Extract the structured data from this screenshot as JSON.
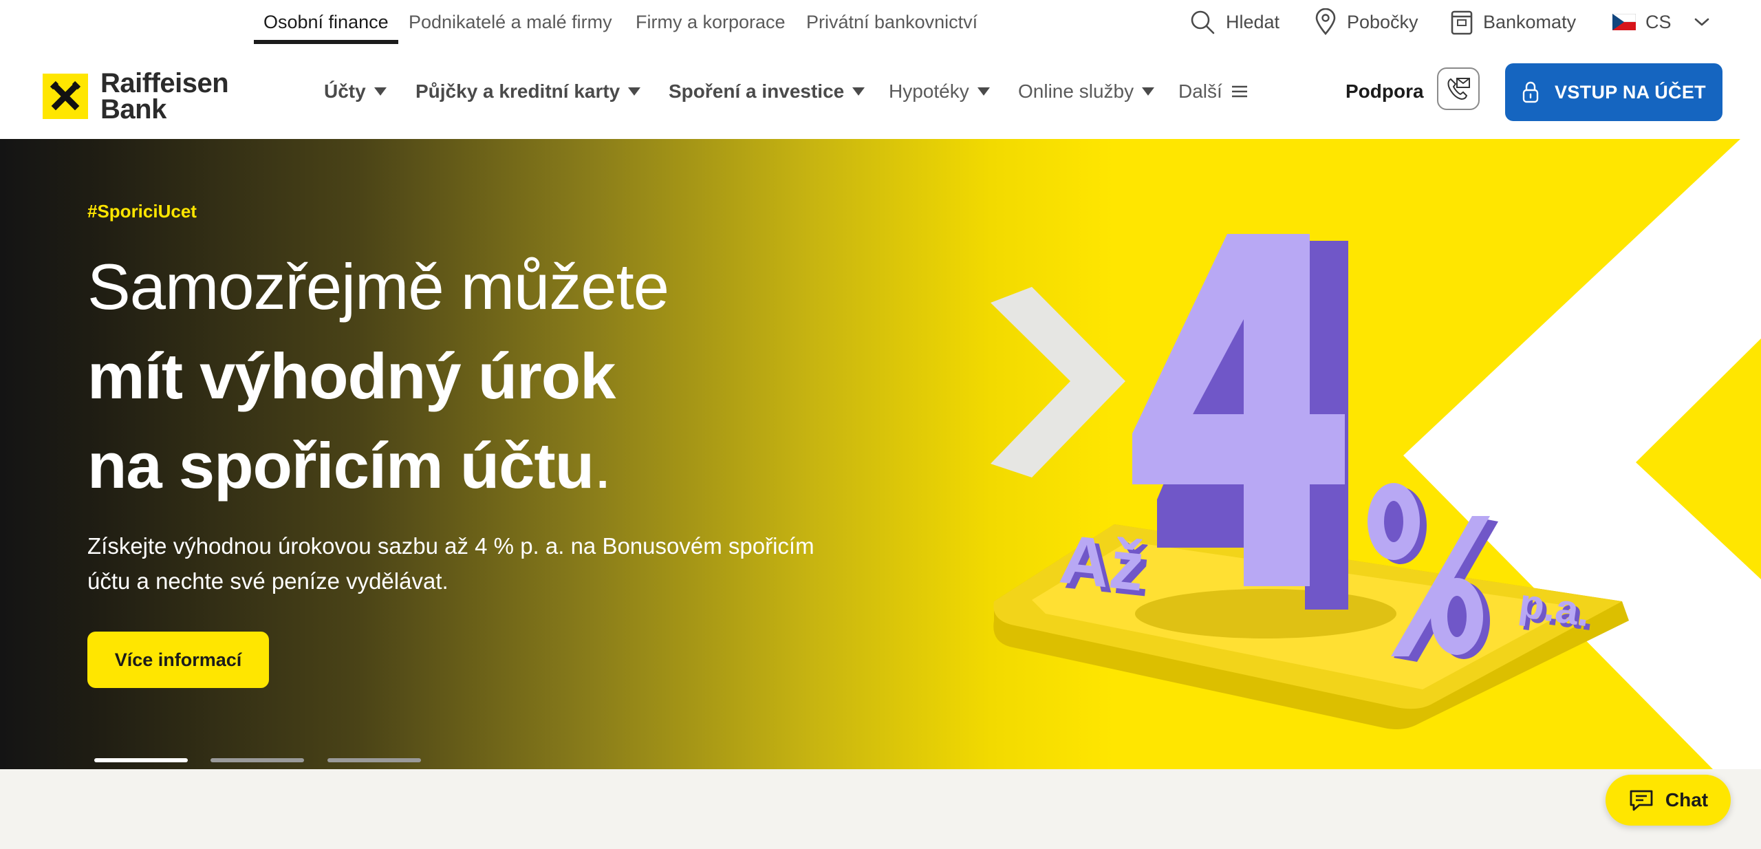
{
  "segments": {
    "items": [
      {
        "label": "Osobní finance",
        "active": true
      },
      {
        "label": "Podnikatelé a malé firmy",
        "active": false
      },
      {
        "label": "Firmy a korporace",
        "active": false
      },
      {
        "label": "Privátní bankovnictví",
        "active": false
      }
    ]
  },
  "utility": {
    "search_label": "Hledat",
    "branches_label": "Pobočky",
    "atms_label": "Bankomaty",
    "language_label": "CS",
    "language_flag": "czech-flag"
  },
  "logo": {
    "line1": "Raiffeisen",
    "line2": "Bank"
  },
  "nav": {
    "items": [
      {
        "label": "Účty",
        "bold": true
      },
      {
        "label": "Půjčky a kreditní karty",
        "bold": true
      },
      {
        "label": "Spoření a investice",
        "bold": true
      },
      {
        "label": "Hypotéky",
        "bold": false
      },
      {
        "label": "Online služby",
        "bold": false
      },
      {
        "label": "Další",
        "bold": false
      }
    ],
    "support_label": "Podpora",
    "login_label": "VSTUP NA ÚČET"
  },
  "hero": {
    "hashtag": "#SporiciUcet",
    "headline_line1": "Samozřejmě můžete",
    "headline_line2": "mít výhodný úrok",
    "headline_line3": "na spořicím účtu",
    "headline_period": ".",
    "subtitle": "Získejte výhodnou úrokovou sazbu až 4 % p. a. na Bonusovém spořicím účtu a nechte své peníze vydělávat.",
    "cta_label": "Více informací",
    "illustration": {
      "prefix": "Až",
      "number": "4",
      "percent": "%",
      "suffix": "p.a."
    },
    "slides": {
      "count": 3,
      "active_index": 0
    }
  },
  "chat": {
    "label": "Chat"
  },
  "colors": {
    "brand_yellow": "#ffe600",
    "login_blue": "#1565c0",
    "hero_dark": "#141414",
    "page_bg": "#f4f3ef",
    "illustration_purple": "#b8a8f4"
  }
}
